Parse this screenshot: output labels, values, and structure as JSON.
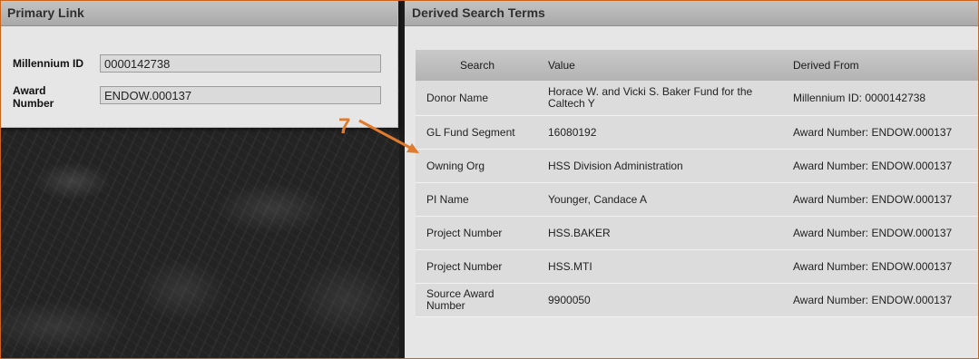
{
  "primary": {
    "title": "Primary Link",
    "millennium_label": "Millennium ID",
    "millennium_value": "0000142738",
    "award_label": "Award Number",
    "award_value": "ENDOW.000137"
  },
  "derived": {
    "title": "Derived Search Terms",
    "columns": [
      "Search",
      "Value",
      "Derived From"
    ],
    "rows": [
      {
        "search": "Donor Name",
        "value": "Horace W. and Vicki S. Baker Fund for the Caltech Y",
        "from": "Millennium ID: 0000142738"
      },
      {
        "search": "GL Fund Segment",
        "value": "16080192",
        "from": "Award Number: ENDOW.000137"
      },
      {
        "search": "Owning Org",
        "value": "HSS Division Administration",
        "from": "Award Number: ENDOW.000137"
      },
      {
        "search": "PI Name",
        "value": "Younger, Candace A",
        "from": "Award Number: ENDOW.000137"
      },
      {
        "search": "Project Number",
        "value": "HSS.BAKER",
        "from": "Award Number: ENDOW.000137"
      },
      {
        "search": "Project Number",
        "value": "HSS.MTI",
        "from": "Award Number: ENDOW.000137"
      },
      {
        "search": "Source Award Number",
        "value": "9900050",
        "from": "Award Number: ENDOW.000137"
      }
    ]
  },
  "annotation": {
    "number": "7",
    "color": "#e07a2c"
  },
  "colors": {
    "accent_border": "#c8641e",
    "header_bg": "#b3b3b3",
    "row_bg": "#dcdcdc"
  }
}
